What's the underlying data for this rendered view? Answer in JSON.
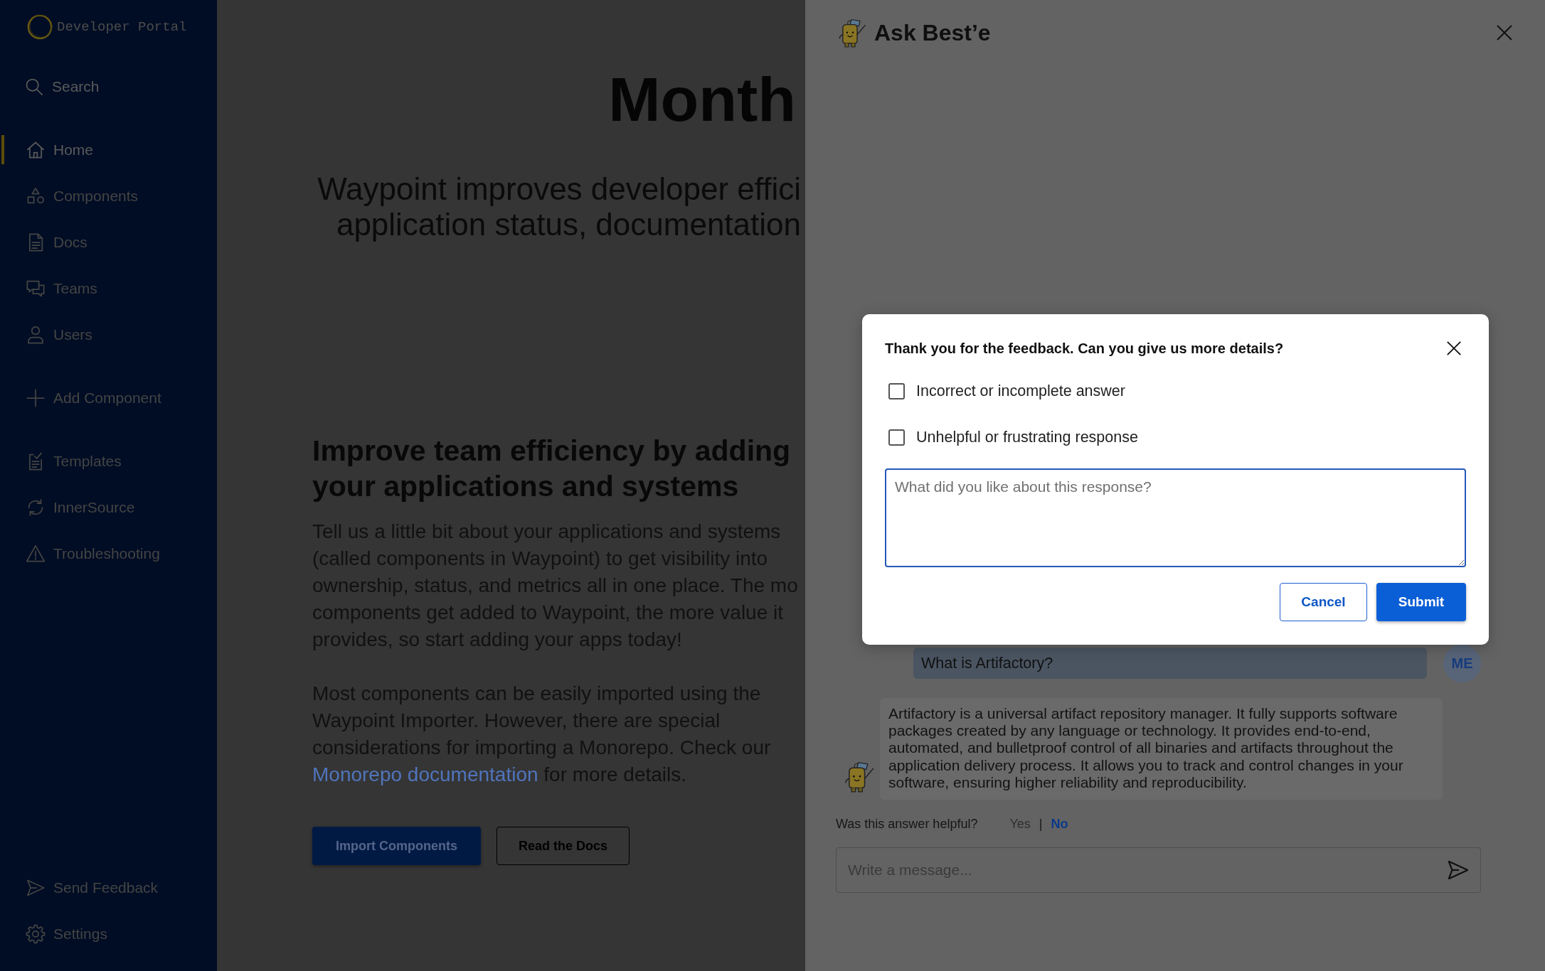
{
  "sidebar": {
    "logo_text": "Developer Portal",
    "search_label": "Search",
    "groups": [
      {
        "items": [
          {
            "label": "Home",
            "selected": true
          },
          {
            "label": "Components",
            "selected": false
          },
          {
            "label": "Docs",
            "selected": false
          },
          {
            "label": "Teams",
            "selected": false
          },
          {
            "label": "Users",
            "selected": false
          }
        ]
      },
      {
        "items": [
          {
            "label": "Add Component",
            "selected": false
          }
        ]
      },
      {
        "items": [
          {
            "label": "Templates",
            "selected": false
          },
          {
            "label": "InnerSource",
            "selected": false
          },
          {
            "label": "Troubleshooting",
            "selected": false
          }
        ]
      }
    ],
    "footer_items": [
      {
        "label": "Send Feedback",
        "selected": false
      },
      {
        "label": "Settings",
        "selected": false
      }
    ]
  },
  "main": {
    "headline": "Month",
    "subtitle_lines": [
      "Waypoint improves developer effici",
      "application status, documentation"
    ],
    "section_title": "Improve team efficiency by adding your applications and systems",
    "intro_lines": [
      "Tell us a little bit about your applications and systems",
      "(called components in Waypoint) to get visibility into",
      "ownership, status, and metrics all in one place. The mo",
      "components get added to Waypoint, the more value it",
      "provides, so start adding your apps today!"
    ],
    "import_note": {
      "lines": [
        "Most components can be easily imported using the",
        "Waypoint Importer. However, there are special",
        "considerations for importing a Monorepo. Check our"
      ],
      "link": "Monorepo documentation",
      "link_suffix": "for more details."
    },
    "buttons": [
      {
        "label": "Import Components",
        "kind": "primary"
      },
      {
        "label": "Read the Docs",
        "kind": "secondary"
      }
    ]
  },
  "assistant_panel": {
    "title": "Ask Best’e",
    "messages": [
      {
        "kind": "user",
        "text": "What is Artifactory?",
        "avatar": "ME"
      },
      {
        "kind": "bot",
        "text": "Artifactory is a universal artifact repository manager. It fully supports software packages created by any language or technology. It provides end-to-end, automated, and bulletproof control of all binaries and artifacts throughout the application delivery process. It allows you to track and control changes in your software, ensuring higher reliability and reproducibility."
      }
    ],
    "helpful_prompt": "Was this answer helpful?",
    "helpful_options": [
      {
        "label": "Yes",
        "selected": false
      },
      {
        "label": "No",
        "selected": true
      }
    ],
    "helpful_separator": "|",
    "message_input": {
      "placeholder": "Write a message..."
    }
  },
  "feedback_dialog": {
    "title": "Thank you for the feedback. Can you give us more details?",
    "options": [
      {
        "label": "Incorrect or incomplete answer",
        "checked": false
      },
      {
        "label": "Unhelpful or frustrating response",
        "checked": false
      }
    ],
    "comment": {
      "placeholder": "What did you like about this response?"
    },
    "buttons": [
      {
        "label": "Cancel",
        "kind": "secondary"
      },
      {
        "label": "Submit",
        "kind": "primary"
      }
    ]
  }
}
